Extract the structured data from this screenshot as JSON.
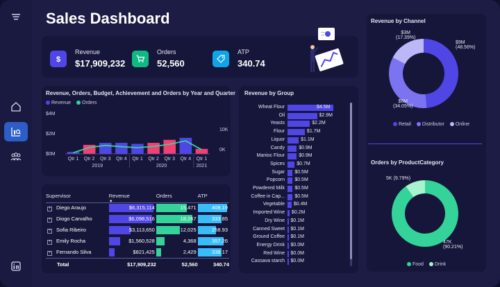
{
  "app": {
    "title": "Sales Dashboard"
  },
  "sidebar": {
    "items": [
      {
        "icon": "menu-icon",
        "active": false
      },
      {
        "icon": "home-icon",
        "active": false
      },
      {
        "icon": "analytics-icon",
        "active": true
      },
      {
        "icon": "users-icon",
        "active": false
      },
      {
        "icon": "linkedin-icon",
        "active": false
      }
    ]
  },
  "kpis": [
    {
      "label": "Revenue",
      "value": "$17,909,232",
      "icon": "dollar-icon",
      "color": "#4f46e5"
    },
    {
      "label": "Orders",
      "value": "52,560",
      "icon": "cart-icon",
      "color": "#10b981"
    },
    {
      "label": "ATP",
      "value": "340.74",
      "icon": "tag-icon",
      "color": "#0ea5e9"
    }
  ],
  "colors": {
    "revenue": "#4f46e5",
    "orders": "#34d399",
    "budget_over": "#f43f74",
    "atp": "#38bdf8",
    "food": "#34d399",
    "drink": "#a7f3d0",
    "retail": "#4f46e5",
    "distributor": "#7c73f0",
    "online": "#bcb8f7"
  },
  "combo_chart": {
    "title": "Revenue, Orders, Budget, Achievement and Orders by Year and Quarter",
    "legend": [
      "Revenue",
      "Orders"
    ]
  },
  "group_chart": {
    "title": "Revenue by Group"
  },
  "channel_chart": {
    "title": "Revenue by Channel",
    "labels": [
      {
        "value": "$9M",
        "pct": "(48.56%)"
      },
      {
        "value": "$6M",
        "pct": "(34.05%)"
      },
      {
        "value": "$3M",
        "pct": "(17.39%)"
      }
    ],
    "legend": [
      "Retail",
      "Distributor",
      "Online"
    ]
  },
  "category_chart": {
    "title": "Orders by ProductCategory",
    "labels": [
      {
        "value": "5K",
        "pct": "(9.79%)"
      },
      {
        "value": "47K",
        "pct": "(90.21%)"
      }
    ],
    "legend": [
      "Food",
      "Drink"
    ]
  },
  "table": {
    "headers": [
      "Supervisor",
      "Revenue",
      "Orders",
      "ATP"
    ],
    "rows": [
      {
        "name": "Diego Araujo",
        "revenue": "$6,315,114",
        "orders": "15,471",
        "atp": "408.19",
        "rev_frac": 1.0,
        "ord_frac": 0.85,
        "atp_frac": 1.0
      },
      {
        "name": "Diogo Carvalho",
        "revenue": "$6,098,516",
        "orders": "18,267",
        "atp": "333.85",
        "rev_frac": 0.97,
        "ord_frac": 1.0,
        "atp_frac": 0.82
      },
      {
        "name": "Sofia Ribeiro",
        "revenue": "$3,113,650",
        "orders": "12,025",
        "atp": "258.93",
        "rev_frac": 0.49,
        "ord_frac": 0.66,
        "atp_frac": 0.63
      },
      {
        "name": "Emily Rocha",
        "revenue": "$1,560,528",
        "orders": "4,368",
        "atp": "357.26",
        "rev_frac": 0.25,
        "ord_frac": 0.24,
        "atp_frac": 0.88
      },
      {
        "name": "Fernando Silva",
        "revenue": "$821,425",
        "orders": "2,429",
        "atp": "338.17",
        "rev_frac": 0.13,
        "ord_frac": 0.13,
        "atp_frac": 0.83
      }
    ],
    "total": {
      "label": "Total",
      "revenue": "$17,909,232",
      "orders": "52,560",
      "atp": "340.74"
    }
  },
  "chart_data": [
    {
      "type": "bar",
      "title": "Revenue, Orders, Budget, Achievement and Orders by Year and Quarter",
      "categories": [
        "Qtr 1",
        "Qtr 2",
        "Qtr 3",
        "Qtr 4",
        "Qtr 1",
        "Qtr 2",
        "Qtr 3",
        "Qtr 4",
        "Qtr 1"
      ],
      "years": [
        {
          "label": "2019",
          "span": 4
        },
        {
          "label": "2020",
          "span": 4
        },
        {
          "label": "2021",
          "span": 1
        }
      ],
      "series": [
        {
          "name": "Revenue",
          "values": [
            0.2,
            0.9,
            1.1,
            1.1,
            1.0,
            1.1,
            1.4,
            1.6,
            0.5
          ],
          "above_budget": [
            false,
            true,
            false,
            false,
            false,
            true,
            true,
            false,
            true
          ]
        },
        {
          "name": "Orders",
          "values": [
            600,
            3200,
            4200,
            3600,
            3100,
            3700,
            4800,
            6500,
            2100
          ]
        }
      ],
      "y_ticks": [
        "$0M",
        "$2M",
        "$4M"
      ],
      "y2_ticks": [
        "0K",
        "10K"
      ],
      "ylim": [
        0,
        4
      ],
      "y2lim": [
        0,
        20000
      ]
    },
    {
      "type": "bar",
      "title": "Revenue by Group",
      "categories": [
        "Wheat Flour",
        "Oil",
        "Yeasts",
        "Flour",
        "Liquor",
        "Candy",
        "Manioc Flour",
        "Spices",
        "Sugar",
        "Popcorn",
        "Powdered Milk",
        "Coffee in Cap...",
        "Vegetable",
        "Imported Wine",
        "Dry Wine",
        "Canned Sweet",
        "Ground Coffee",
        "Energy Drink",
        "Red Wine",
        "Cassava starch"
      ],
      "values": [
        4.5,
        2.9,
        2.2,
        1.7,
        1.1,
        0.9,
        0.9,
        0.7,
        0.5,
        0.5,
        0.5,
        0.5,
        0.4,
        0.2,
        0.1,
        0.1,
        0.1,
        0.0,
        0.0,
        0.0
      ],
      "labels": [
        "$4.5M",
        "$2.9M",
        "$2.2M",
        "$1.7M",
        "$1.1M",
        "$0.9M",
        "$0.9M",
        "$0.7M",
        "$0.5M",
        "$0.5M",
        "$0.5M",
        "$0.5M",
        "$0.4M",
        "$0.2M",
        "$0.1M",
        "$0.1M",
        "$0.1M",
        "$0.0M",
        "$0.0M",
        "$0.0M"
      ]
    },
    {
      "type": "pie",
      "title": "Revenue by Channel",
      "categories": [
        "Retail",
        "Distributor",
        "Online"
      ],
      "values": [
        48.56,
        34.05,
        17.39
      ]
    },
    {
      "type": "pie",
      "title": "Orders by ProductCategory",
      "categories": [
        "Food",
        "Drink"
      ],
      "values": [
        90.21,
        9.79
      ]
    }
  ]
}
